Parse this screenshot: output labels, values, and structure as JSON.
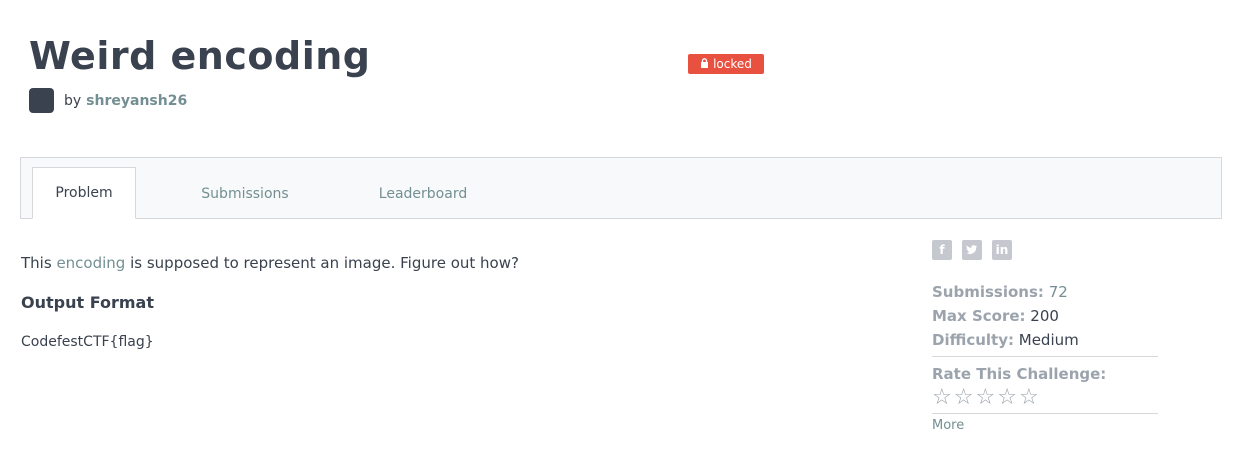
{
  "challenge": {
    "title": "Weird encoding",
    "status_badge": "locked",
    "author_prefix": "by",
    "author": "shreyansh26"
  },
  "tabs": [
    {
      "label": "Problem",
      "active": true
    },
    {
      "label": "Submissions",
      "active": false
    },
    {
      "label": "Leaderboard",
      "active": false
    }
  ],
  "problem": {
    "text_before": "This",
    "link_text": "encoding",
    "text_after": "is supposed to represent an image. Figure out how?",
    "output_heading": "Output Format",
    "output_format": "CodefestCTF{flag}"
  },
  "sidebar": {
    "social_icons": [
      "facebook-icon",
      "twitter-icon",
      "linkedin-icon"
    ],
    "submissions_label": "Submissions:",
    "submissions_value": "72",
    "max_score_label": "Max Score:",
    "max_score_value": "200",
    "difficulty_label": "Difficulty:",
    "difficulty_value": "Medium",
    "rate_label": "Rate This Challenge:",
    "star_rating": 0,
    "more_label": "More"
  },
  "colors": {
    "badge": "#e8503f",
    "text_dark": "#39424e",
    "link": "#738f93",
    "label_gray": "#9ba3ad"
  }
}
